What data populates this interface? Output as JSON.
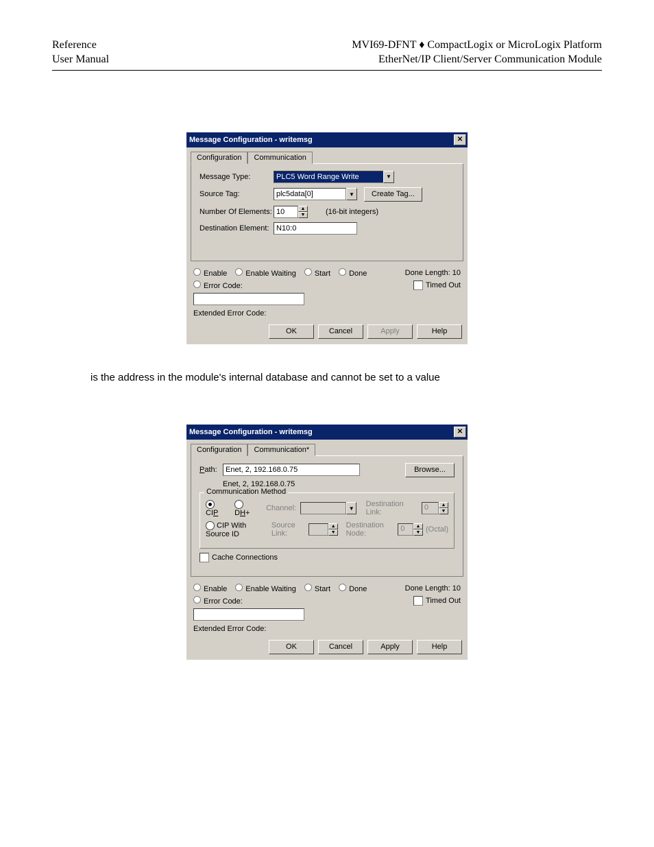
{
  "header": {
    "left_line1": "Reference",
    "left_line2": "User Manual",
    "right_line1": "MVI69-DFNT ♦ CompactLogix or MicroLogix Platform",
    "right_line2": "EtherNet/IP Client/Server Communication Module"
  },
  "body_text": "is the address in the module's internal database and cannot be set to a value",
  "dlg1": {
    "title": "Message Configuration - writemsg",
    "tabs": {
      "config": "Configuration",
      "comm": "Communication"
    },
    "fields": {
      "msg_type_label": "Message Type:",
      "msg_type_value": "PLC5 Word Range Write",
      "source_tag_label": "Source Tag:",
      "source_tag_value": "plc5data[0]",
      "create_tag_btn": "Create Tag...",
      "num_elements_label": "Number Of Elements:",
      "num_elements_value": "10",
      "num_elements_hint": "(16-bit integers)",
      "dest_elem_label": "Destination Element:",
      "dest_elem_value": "N10:0"
    },
    "status": {
      "enable": "Enable",
      "enable_waiting": "Enable Waiting",
      "start": "Start",
      "done": "Done",
      "done_length": "Done Length: 10",
      "error_code_label": "Error Code:",
      "timed_out": "Timed Out",
      "ext_err": "Extended Error Code:"
    },
    "buttons": {
      "ok": "OK",
      "cancel": "Cancel",
      "apply": "Apply",
      "help": "Help"
    }
  },
  "dlg2": {
    "title": "Message Configuration - writemsg",
    "tabs": {
      "config": "Configuration",
      "comm": "Communication*"
    },
    "path_label": "Path:",
    "path_value": "Enet, 2, 192.168.0.75",
    "path_subtext": "Enet, 2, 192.168.0.75",
    "browse_btn": "Browse...",
    "group_title": "Communication Method",
    "cip_label": "CIP",
    "dhp_label": "DH+",
    "channel_label": "Channel:",
    "cip_src_label": "CIP With Source ID",
    "src_link_label": "Source Link:",
    "dest_link_label": "Destination Link:",
    "dest_node_label": "Destination Node:",
    "dest_link_value": "0",
    "dest_node_value": "0",
    "octal_label": "(Octal)",
    "cache_conn": "Cache Connections",
    "status": {
      "enable": "Enable",
      "enable_waiting": "Enable Waiting",
      "start": "Start",
      "done": "Done",
      "done_length": "Done Length: 10",
      "error_code_label": "Error Code:",
      "timed_out": "Timed Out",
      "ext_err": "Extended Error Code:"
    },
    "buttons": {
      "ok": "OK",
      "cancel": "Cancel",
      "apply": "Apply",
      "help": "Help"
    }
  }
}
